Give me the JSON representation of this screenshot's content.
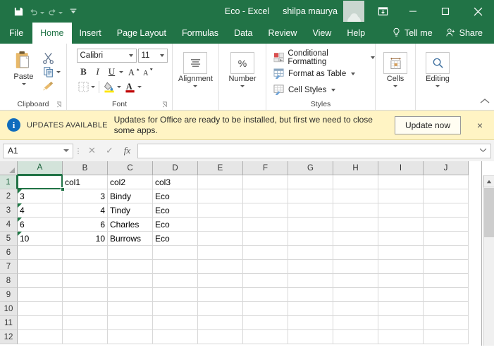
{
  "titlebar": {
    "quick_access": [
      {
        "name": "save-icon",
        "label": "Save",
        "enabled": true
      },
      {
        "name": "undo-icon",
        "label": "Undo",
        "enabled": false
      },
      {
        "name": "redo-icon",
        "label": "Redo",
        "enabled": false
      },
      {
        "name": "customize-quick-access-toolbar-icon",
        "label": "Customize Quick Access Toolbar",
        "enabled": true
      }
    ],
    "document_title": "Eco  -  Excel",
    "user_name": "shilpa maurya",
    "window_buttons": [
      {
        "name": "ribbon-display-options-icon",
        "label": "Ribbon Display Options"
      },
      {
        "name": "minimize-icon",
        "label": "Minimize"
      },
      {
        "name": "maximize-icon",
        "label": "Maximize"
      },
      {
        "name": "close-icon",
        "label": "Close"
      }
    ]
  },
  "tabs": [
    {
      "label": "File",
      "active": false
    },
    {
      "label": "Home",
      "active": true
    },
    {
      "label": "Insert",
      "active": false
    },
    {
      "label": "Page Layout",
      "active": false
    },
    {
      "label": "Formulas",
      "active": false
    },
    {
      "label": "Data",
      "active": false
    },
    {
      "label": "Review",
      "active": false
    },
    {
      "label": "View",
      "active": false
    },
    {
      "label": "Help",
      "active": false
    }
  ],
  "tab_right": {
    "tell_me": "Tell me",
    "share": "Share"
  },
  "ribbon": {
    "clipboard": {
      "group_label": "Clipboard",
      "paste_label": "Paste",
      "cut_label": "Cut",
      "copy_label": "Copy",
      "format_painter_label": "Format Painter"
    },
    "font": {
      "group_label": "Font",
      "font_name": "Calibri",
      "font_size": "11",
      "bold": "B",
      "italic": "I",
      "underline": "U",
      "grow_font": "A",
      "shrink_font": "A",
      "borders_label": "Borders",
      "fill_color_label": "Fill Color",
      "font_color_label": "Font Color"
    },
    "alignment": {
      "group_label": "Alignment",
      "button_label": "Alignment"
    },
    "number": {
      "group_label": "Number",
      "button_label": "Number",
      "symbol": "%"
    },
    "styles": {
      "group_label": "Styles",
      "items": [
        {
          "label": "Conditional Formatting"
        },
        {
          "label": "Format as Table"
        },
        {
          "label": "Cell Styles"
        }
      ]
    },
    "cells": {
      "group_label": "",
      "button_label": "Cells"
    },
    "editing": {
      "group_label": "",
      "button_label": "Editing"
    },
    "collapse_label": "Collapse the Ribbon"
  },
  "notification": {
    "badge": "i",
    "title": "UPDATES AVAILABLE",
    "message": "Updates for Office are ready to be installed, but first we need to close some apps.",
    "button_label": "Update now",
    "close_label": "×",
    "bg_color": "#fff4c4",
    "icon_color": "#0f6cbd"
  },
  "formula_bar": {
    "name_box_value": "A1",
    "cancel_label": "✕",
    "enter_label": "✓",
    "function_label": "fx",
    "formula_value": "",
    "expand_label": "⌄"
  },
  "grid": {
    "columns": [
      "A",
      "B",
      "C",
      "D",
      "E",
      "F",
      "G",
      "H",
      "I",
      "J"
    ],
    "selected_column": "A",
    "rows": [
      "1",
      "2",
      "3",
      "4",
      "5",
      "6",
      "7",
      "8",
      "9",
      "10",
      "11",
      "12"
    ],
    "selected_row": "1",
    "selected_cell": "A1",
    "data": [
      {
        "row": "1",
        "cells": [
          {
            "col": "A",
            "value": "",
            "align": "left",
            "error": false
          },
          {
            "col": "B",
            "value": "col1",
            "align": "left",
            "error": false
          },
          {
            "col": "C",
            "value": "col2",
            "align": "left",
            "error": false
          },
          {
            "col": "D",
            "value": "col3",
            "align": "left",
            "error": false
          }
        ]
      },
      {
        "row": "2",
        "cells": [
          {
            "col": "A",
            "value": "3",
            "align": "left",
            "error": true
          },
          {
            "col": "B",
            "value": "3",
            "align": "right",
            "error": false
          },
          {
            "col": "C",
            "value": "Bindy",
            "align": "left",
            "error": false
          },
          {
            "col": "D",
            "value": "Eco",
            "align": "left",
            "error": false
          }
        ]
      },
      {
        "row": "3",
        "cells": [
          {
            "col": "A",
            "value": "4",
            "align": "left",
            "error": true
          },
          {
            "col": "B",
            "value": "4",
            "align": "right",
            "error": false
          },
          {
            "col": "C",
            "value": "Tindy",
            "align": "left",
            "error": false
          },
          {
            "col": "D",
            "value": "Eco",
            "align": "left",
            "error": false
          }
        ]
      },
      {
        "row": "4",
        "cells": [
          {
            "col": "A",
            "value": "6",
            "align": "left",
            "error": true
          },
          {
            "col": "B",
            "value": "6",
            "align": "right",
            "error": false
          },
          {
            "col": "C",
            "value": "Charles",
            "align": "left",
            "error": false
          },
          {
            "col": "D",
            "value": "Eco",
            "align": "left",
            "error": false
          }
        ]
      },
      {
        "row": "5",
        "cells": [
          {
            "col": "A",
            "value": "10",
            "align": "left",
            "error": true
          },
          {
            "col": "B",
            "value": "10",
            "align": "right",
            "error": false
          },
          {
            "col": "C",
            "value": "Burrows",
            "align": "left",
            "error": false
          },
          {
            "col": "D",
            "value": "Eco",
            "align": "left",
            "error": false
          }
        ]
      },
      {
        "row": "6",
        "cells": []
      },
      {
        "row": "7",
        "cells": []
      },
      {
        "row": "8",
        "cells": []
      },
      {
        "row": "9",
        "cells": []
      },
      {
        "row": "10",
        "cells": []
      },
      {
        "row": "11",
        "cells": []
      },
      {
        "row": "12",
        "cells": []
      }
    ]
  },
  "theme": {
    "excel_green": "#217346",
    "error_triangle": "#1d7a45",
    "header_gray": "#e6e6e6"
  }
}
